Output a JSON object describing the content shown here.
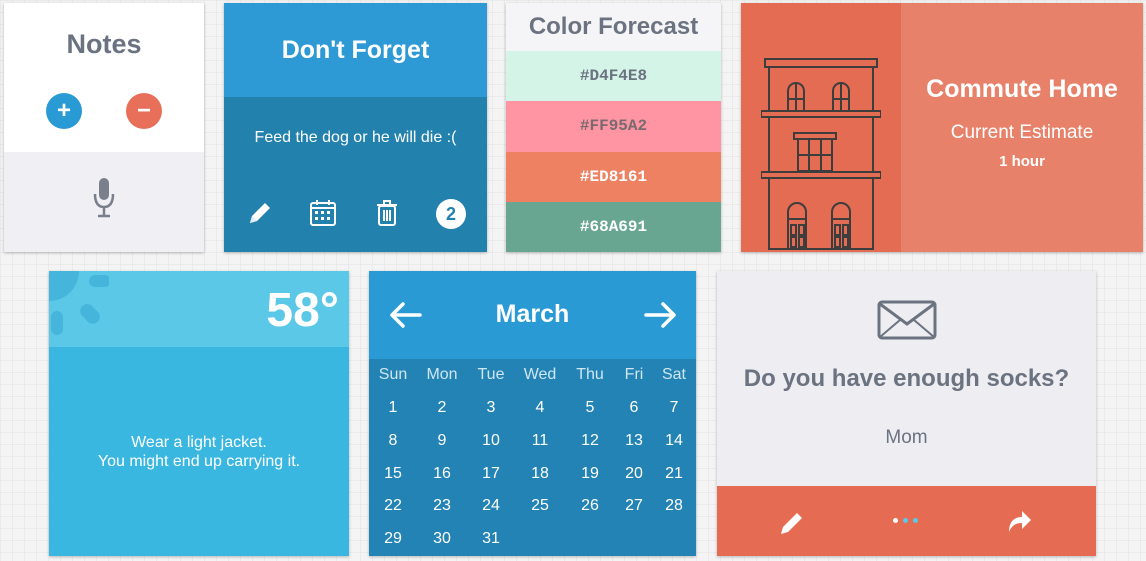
{
  "notes": {
    "title": "Notes",
    "add_label": "+",
    "remove_label": "−"
  },
  "forget": {
    "title": "Don't Forget",
    "message": "Feed the dog or he will die :(",
    "badge_count": "2"
  },
  "forecast": {
    "title": "Color Forecast",
    "swatches": [
      {
        "hex": "#D4F4E8",
        "text_color": "#6b7280"
      },
      {
        "hex": "#FF95A2",
        "text_color": "#7a6a70"
      },
      {
        "hex": "#ED8161",
        "text_color": "#ffffff"
      },
      {
        "hex": "#68A691",
        "text_color": "#ffffff"
      }
    ]
  },
  "commute": {
    "title": "Commute Home",
    "subtitle": "Current Estimate",
    "estimate": "1 hour"
  },
  "weather": {
    "temperature": "58°",
    "line1": "Wear a light jacket.",
    "line2": "You might end up carrying it."
  },
  "calendar": {
    "month": "March",
    "weekdays": [
      "Sun",
      "Mon",
      "Tue",
      "Wed",
      "Thu",
      "Fri",
      "Sat"
    ],
    "days": [
      "1",
      "2",
      "3",
      "4",
      "5",
      "6",
      "7",
      "8",
      "9",
      "10",
      "11",
      "12",
      "13",
      "14",
      "15",
      "16",
      "17",
      "18",
      "19",
      "20",
      "21",
      "22",
      "23",
      "24",
      "25",
      "26",
      "27",
      "28",
      "29",
      "30",
      "31"
    ]
  },
  "message": {
    "question": "Do you have enough socks?",
    "from": "Mom"
  },
  "colors": {
    "blue": "#2d9ad5",
    "blue_dark": "#2381ae",
    "coral": "#e8816a",
    "coral_dark": "#e36c53",
    "sky": "#39b7e1",
    "gray_text": "#6b7280"
  }
}
